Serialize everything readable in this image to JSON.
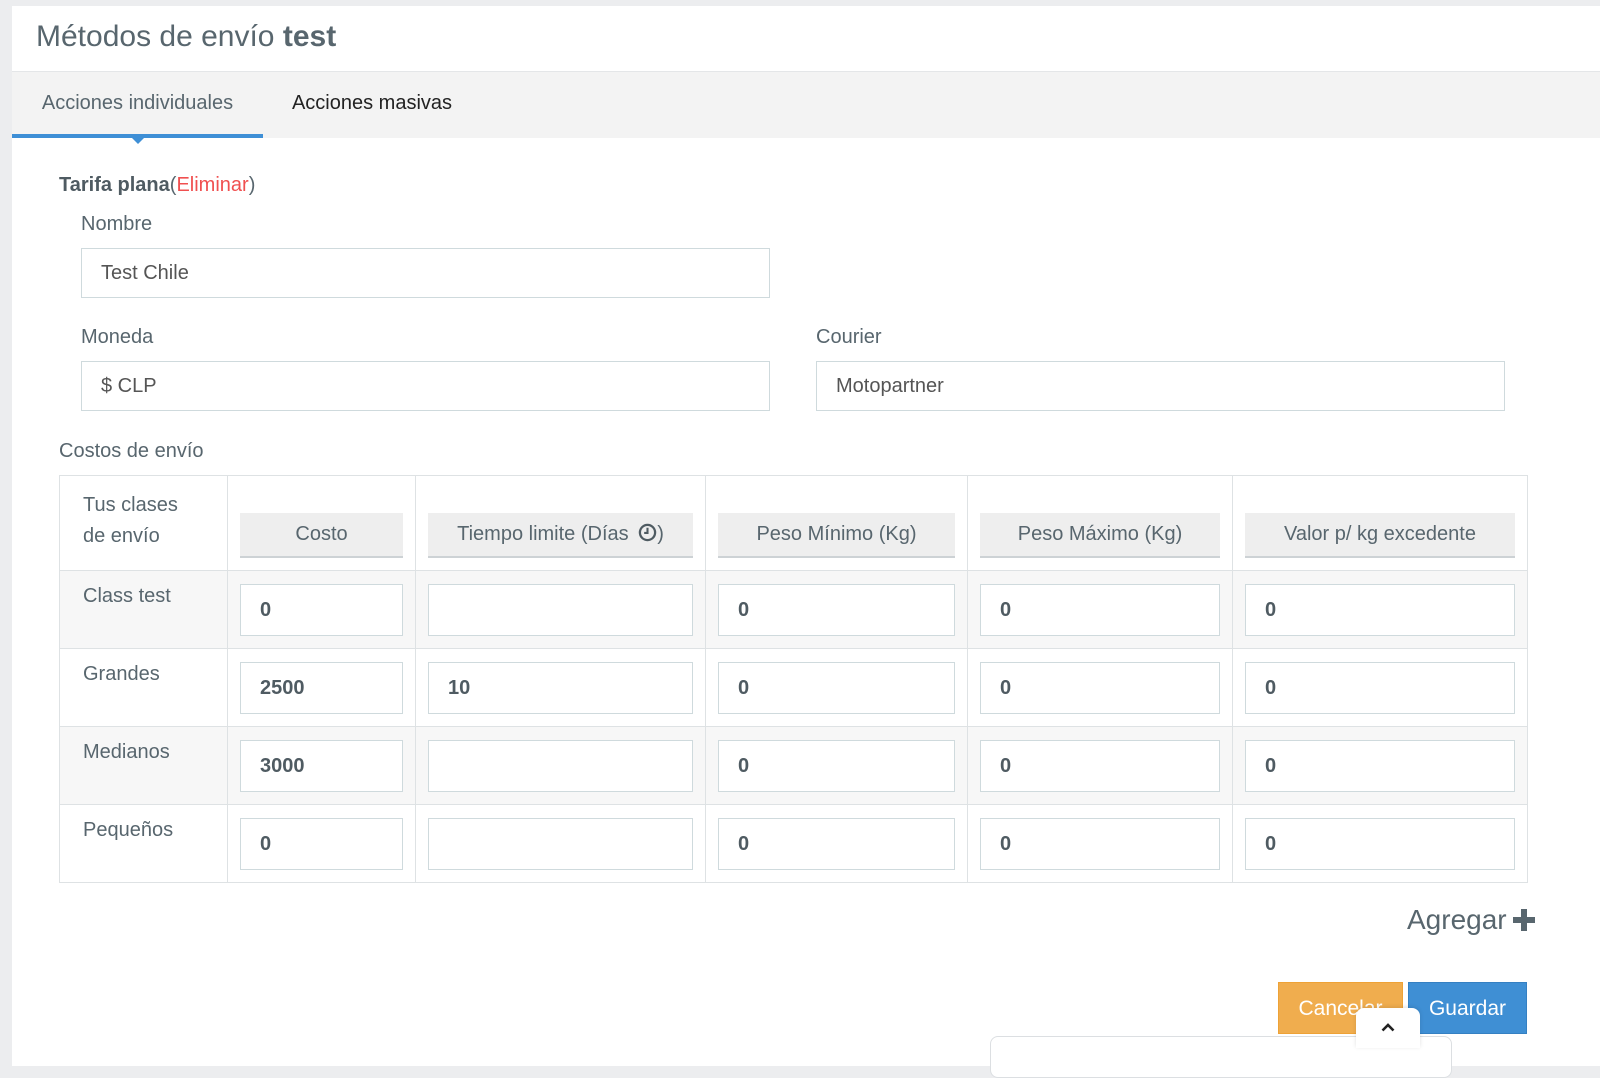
{
  "header": {
    "title_prefix": "Métodos de envío",
    "title_store": "test"
  },
  "tabs": [
    {
      "label": "Acciones individuales",
      "active": true
    },
    {
      "label": "Acciones masivas",
      "active": false
    }
  ],
  "method": {
    "name_bold": "Tarifa plana",
    "paren_open": "(",
    "delete_label": "Eliminar",
    "paren_close": ")"
  },
  "form": {
    "nombre_label": "Nombre",
    "nombre_value": "Test Chile",
    "moneda_label": "Moneda",
    "moneda_value": "$ CLP",
    "courier_label": "Courier",
    "courier_value": "Motopartner"
  },
  "costs": {
    "section_label": "Costos de envío",
    "first_col_line1": "Tus clases",
    "first_col_line2": "de envío",
    "columns": [
      "Costo",
      "Tiempo limite (Días",
      "Peso Mínimo (Kg)",
      "Peso Máximo (Kg)",
      "Valor p/ kg excedente"
    ],
    "tiempo_suffix": ")",
    "rows": [
      {
        "name": "Class test",
        "values": [
          "0",
          "",
          "0",
          "0",
          "0"
        ]
      },
      {
        "name": "Grandes",
        "values": [
          "2500",
          "10",
          "0",
          "0",
          "0"
        ]
      },
      {
        "name": "Medianos",
        "values": [
          "3000",
          "",
          "0",
          "0",
          "0"
        ]
      },
      {
        "name": "Pequeños",
        "values": [
          "0",
          "",
          "0",
          "0",
          "0"
        ]
      }
    ]
  },
  "actions": {
    "add_label": "Agregar",
    "cancel_label": "Cancelar",
    "save_label": "Guardar"
  },
  "colors": {
    "accent": "#3e8fd6",
    "danger": "#f05050",
    "warning": "#f0ad4e",
    "primary": "#3f8fd4"
  },
  "icons": [
    "clock-icon",
    "plus-icon",
    "chevron-up-icon"
  ]
}
